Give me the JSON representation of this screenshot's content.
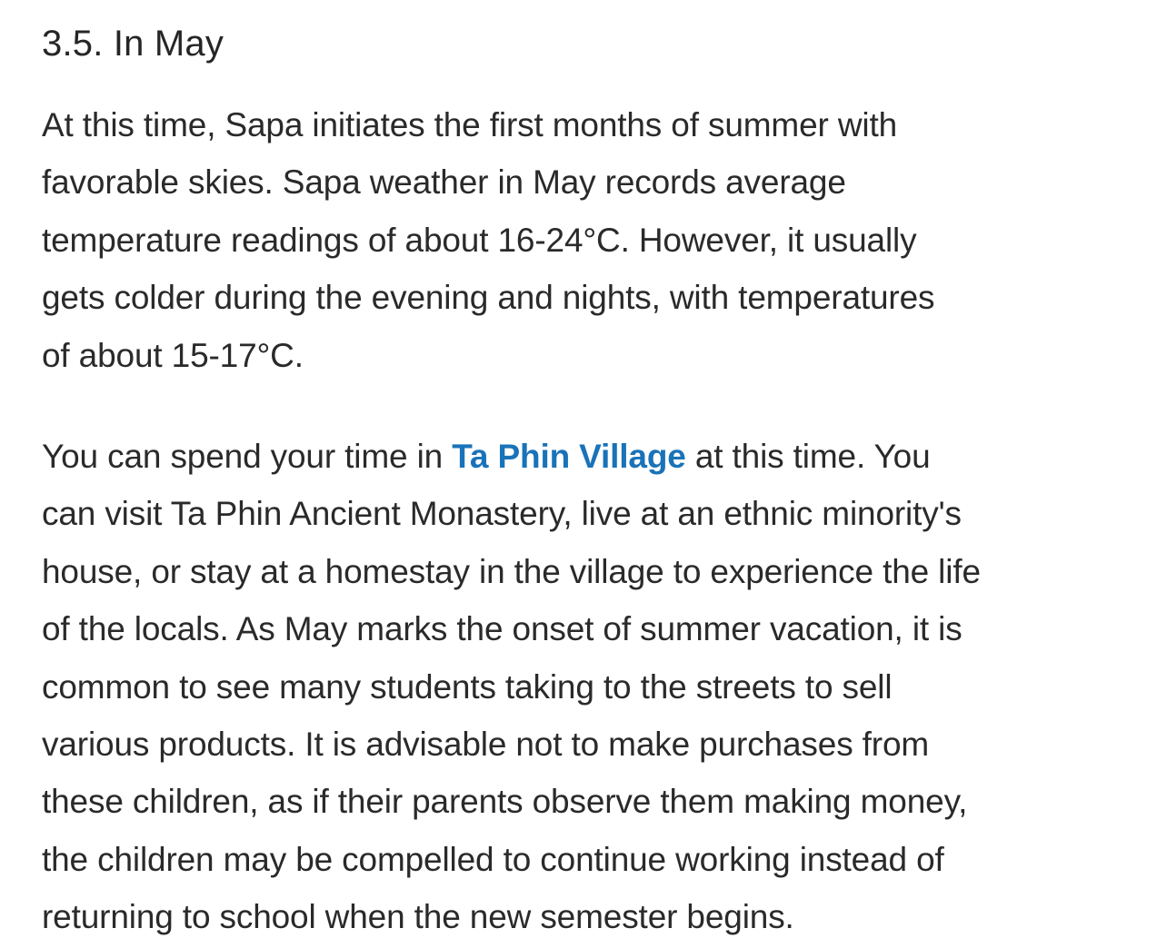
{
  "article": {
    "heading": "3.5. In May",
    "paragraph1": {
      "lines": [
        "At this time, Sapa initiates the first months of summer with",
        "favorable skies. Sapa weather in May records average",
        "temperature readings of about 16-24°C. However, it usually",
        "gets colder during the evening and nights, with temperatures",
        "of about 15-17°C."
      ]
    },
    "paragraph2": {
      "line1_before_link": "You can spend your time in ",
      "link_text": "Ta Phin Village",
      "line1_after_link": " at this time. You",
      "lines": [
        "can visit Ta Phin Ancient Monastery, live at an ethnic minority's",
        "house, or stay at a homestay in the village to experience the life",
        "of the locals. As May marks the onset of summer vacation, it is",
        "common to see many students taking to the streets to sell",
        "various products. It is advisable not to make purchases from",
        "these children, as if their parents observe them making money,",
        "the children may be compelled to continue working instead of",
        "returning to school when the new semester begins."
      ]
    }
  },
  "colors": {
    "text": "#262626",
    "link": "#1a73b8",
    "background": "#ffffff"
  }
}
